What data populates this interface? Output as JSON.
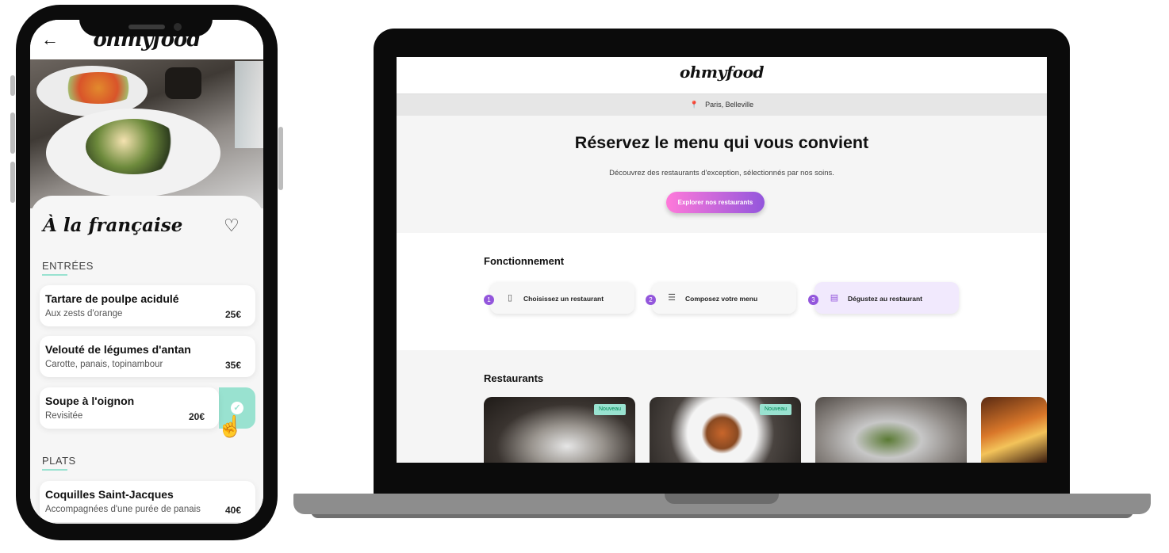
{
  "mobile": {
    "back_icon": "arrow-left-icon",
    "logo": "ohmyfood",
    "restaurant_name": "À la française",
    "heart_icon": "heart-outline-icon",
    "sections": [
      {
        "title": "ENTRÉES",
        "items": [
          {
            "name": "Tartare de poulpe acidulé",
            "description": "Aux zests d'orange",
            "price": "25€"
          },
          {
            "name": "Velouté de légumes d'antan",
            "description": "Carotte, panais, topinambour",
            "price": "35€"
          },
          {
            "name": "Soupe à l'oignon",
            "description": "Revisitée",
            "price": "20€",
            "selected": true
          }
        ]
      },
      {
        "title": "PLATS",
        "items": [
          {
            "name": "Coquilles Saint-Jacques",
            "description": "Accompagnées d'une purée de panais",
            "price": "40€"
          }
        ]
      }
    ],
    "accent_color": "#99e2d0"
  },
  "desktop": {
    "logo": "ohmyfood",
    "location": "Paris, Belleville",
    "location_icon": "map-pin-icon",
    "hero_title": "Réservez le menu qui vous convient",
    "hero_subtitle": "Découvrez des restaurants d'exception, sélectionnés par nos soins.",
    "cta_label": "Explorer nos restaurants",
    "how_title": "Fonctionnement",
    "steps": [
      {
        "number": "1",
        "icon": "phone-icon",
        "label": "Choisissez un restaurant"
      },
      {
        "number": "2",
        "icon": "list-icon",
        "label": "Composez votre menu"
      },
      {
        "number": "3",
        "icon": "store-icon",
        "label": "Dégustez au restaurant"
      }
    ],
    "restaurants_title": "Restaurants",
    "badge_new": "Nouveau",
    "colors": {
      "primary": "#9356dc",
      "secondary": "#ff79da",
      "tertiary": "#99e2d0"
    }
  }
}
